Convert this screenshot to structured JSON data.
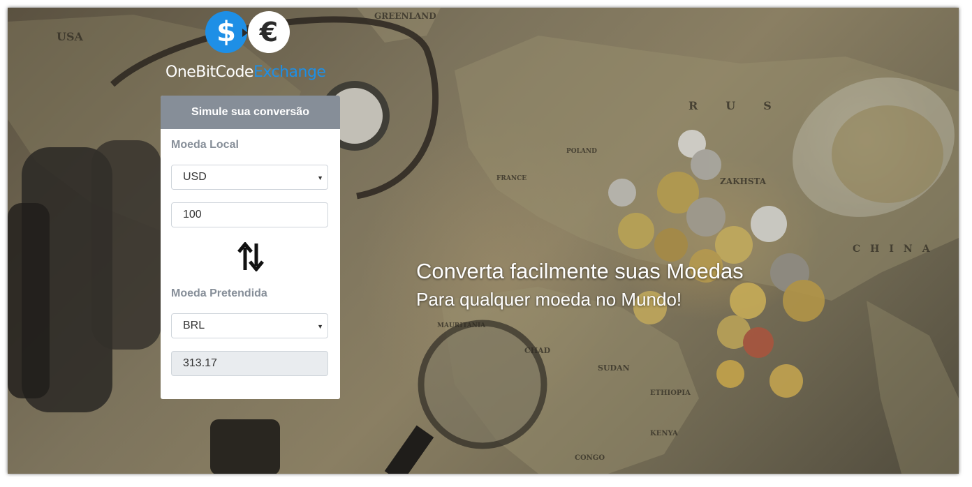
{
  "logo": {
    "dollar_symbol": "$",
    "euro_symbol": "€",
    "name_part1": "OneBitCode",
    "name_part2": "Exchange"
  },
  "converter": {
    "header": "Simule sua conversão",
    "local": {
      "label": "Moeda Local",
      "selected": "USD",
      "amount": "100"
    },
    "swap_icon": "swap-vertical-arrows-icon",
    "target": {
      "label": "Moeda Pretendida",
      "selected": "BRL",
      "result": "313.17"
    }
  },
  "hero": {
    "title": "Converta facilmente suas Moedas",
    "subtitle": "Para qualquer moeda no Mundo!"
  },
  "colors": {
    "accent": "#1e8fe6",
    "card_header": "#868e98"
  }
}
